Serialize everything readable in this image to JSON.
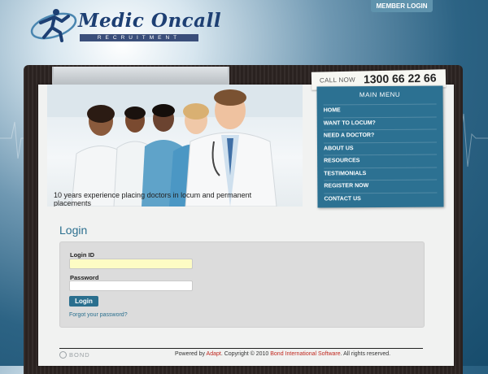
{
  "header": {
    "logo_title": "Medic Oncall",
    "logo_subtitle": "RECRUITMENT",
    "member_login": "MEMBER LOGIN"
  },
  "hero": {
    "caption": "10 years experience placing doctors in locum and permanent placements"
  },
  "call": {
    "label": "CALL NOW",
    "number": "1300 66 22 66"
  },
  "menu": {
    "title": "MAIN MENU",
    "items": [
      {
        "label": "HOME"
      },
      {
        "label": "WANT TO LOCUM?"
      },
      {
        "label": "NEED A DOCTOR?"
      },
      {
        "label": "ABOUT US"
      },
      {
        "label": "RESOURCES"
      },
      {
        "label": "TESTIMONIALS"
      },
      {
        "label": "REGISTER NOW"
      },
      {
        "label": "CONTACT US"
      }
    ]
  },
  "login": {
    "title": "Login",
    "login_id_label": "Login ID",
    "login_id_value": "",
    "password_label": "Password",
    "password_value": "",
    "button_label": "Login",
    "forgot_label": "Forgot your password?"
  },
  "footer": {
    "bond_label": "BOND",
    "powered_by": "Powered by ",
    "adapt_link": "Adapt",
    "copyright": ". Copyright © 2010 ",
    "bond_link": "Bond International Software",
    "rights": ". All rights reserved."
  },
  "colors": {
    "accent": "#2a6f8e",
    "menu_bg": "#2c7192",
    "login_id_highlight": "#fdfcc4",
    "footer_link": "#c0281f"
  }
}
